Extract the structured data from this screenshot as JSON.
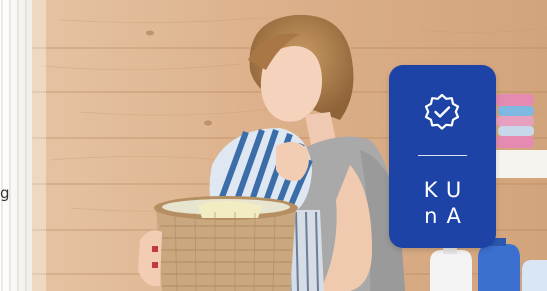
{
  "hero": {
    "edge_text": "g",
    "badge": {
      "line1": "KU",
      "line2": "nA",
      "color": "#1e43a7",
      "icon": "verified-badge-check-icon"
    }
  }
}
